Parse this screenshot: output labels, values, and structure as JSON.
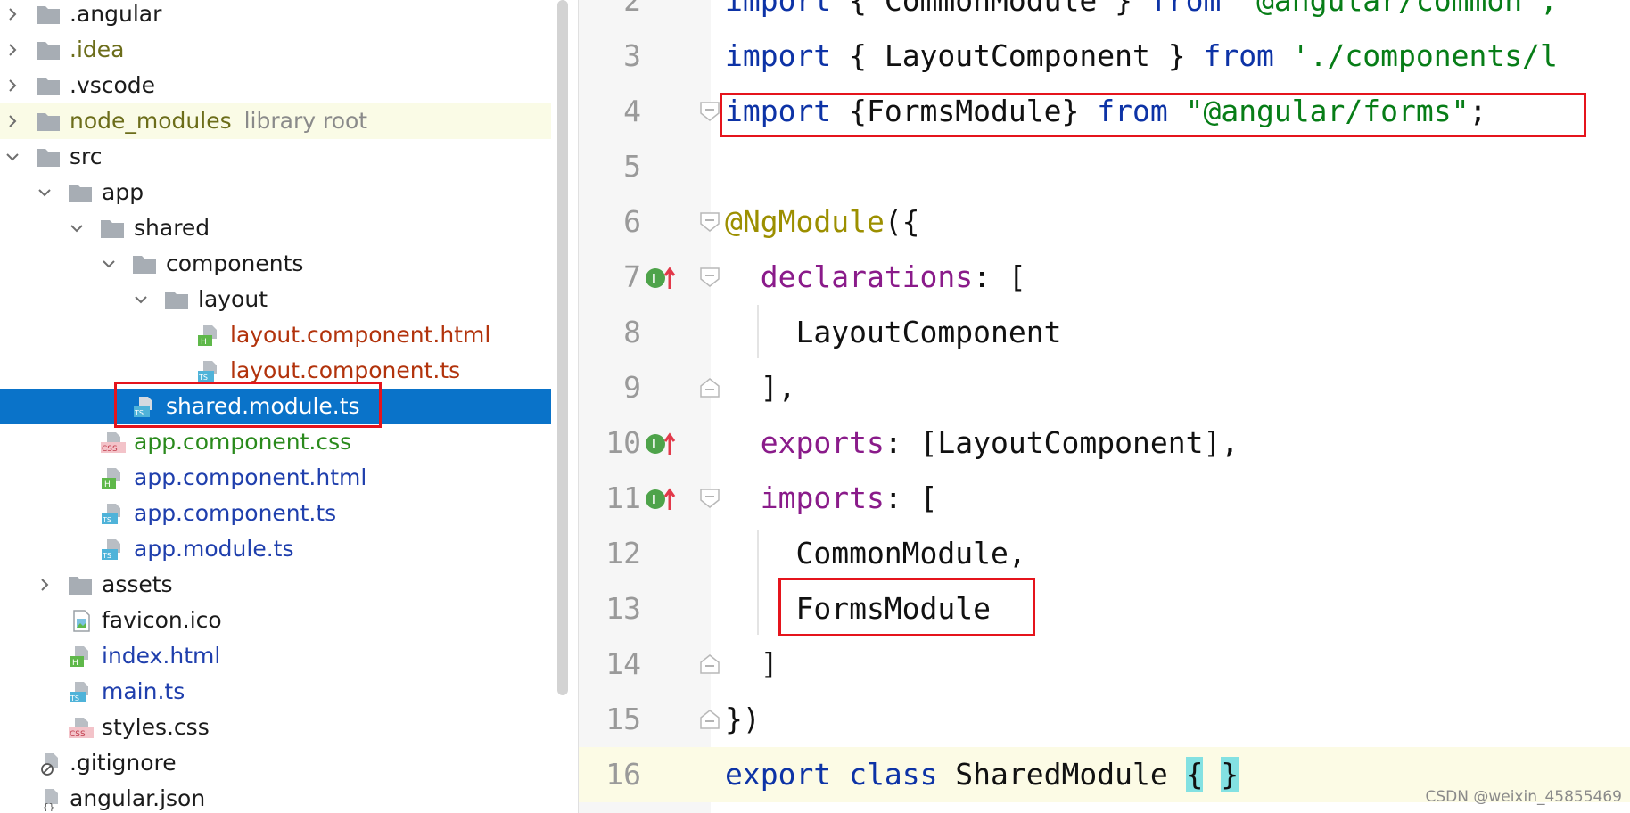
{
  "project_tree": {
    "items": [
      {
        "label": ".angular",
        "hint": "",
        "icon": "folder-icon",
        "expanded": false
      },
      {
        "label": ".idea",
        "hint": "",
        "icon": "folder-icon",
        "expanded": false
      },
      {
        "label": ".vscode",
        "hint": "",
        "icon": "folder-icon",
        "expanded": false
      },
      {
        "label": "node_modules",
        "hint": "library root",
        "icon": "folder-icon",
        "expanded": false
      },
      {
        "label": "src",
        "hint": "",
        "icon": "folder-icon",
        "expanded": true
      },
      {
        "label": "app",
        "hint": "",
        "icon": "folder-icon",
        "expanded": true
      },
      {
        "label": "shared",
        "hint": "",
        "icon": "folder-icon",
        "expanded": true
      },
      {
        "label": "components",
        "hint": "",
        "icon": "folder-icon",
        "expanded": true
      },
      {
        "label": "layout",
        "hint": "",
        "icon": "folder-icon",
        "expanded": true
      },
      {
        "label": "layout.component.html",
        "hint": "",
        "icon": "html-file-icon",
        "badge": "H"
      },
      {
        "label": "layout.component.ts",
        "hint": "",
        "icon": "ts-file-icon",
        "badge": "TS"
      },
      {
        "label": "shared.module.ts",
        "hint": "",
        "icon": "ts-file-icon",
        "badge": "TS",
        "selected": true
      },
      {
        "label": "app.component.css",
        "hint": "",
        "icon": "css-file-icon",
        "badge": "CSS"
      },
      {
        "label": "app.component.html",
        "hint": "",
        "icon": "html-file-icon",
        "badge": "H"
      },
      {
        "label": "app.component.ts",
        "hint": "",
        "icon": "ts-file-icon",
        "badge": "TS"
      },
      {
        "label": "app.module.ts",
        "hint": "",
        "icon": "ts-file-icon",
        "badge": "TS"
      },
      {
        "label": "assets",
        "hint": "",
        "icon": "folder-icon",
        "expanded": false
      },
      {
        "label": "favicon.ico",
        "hint": "",
        "icon": "image-file-icon"
      },
      {
        "label": "index.html",
        "hint": "",
        "icon": "html-file-icon",
        "badge": "H"
      },
      {
        "label": "main.ts",
        "hint": "",
        "icon": "ts-file-icon",
        "badge": "TS"
      },
      {
        "label": "styles.css",
        "hint": "",
        "icon": "css-file-icon",
        "badge": "CSS"
      },
      {
        "label": ".gitignore",
        "hint": "",
        "icon": "ignore-file-icon"
      },
      {
        "label": "angular.json",
        "hint": "",
        "icon": "json-file-icon"
      }
    ]
  },
  "editor": {
    "lines": [
      {
        "number": "2",
        "tokens": [
          {
            "t": "import",
            "c": "kw"
          },
          {
            "t": " { CommonModule } ",
            "c": ""
          },
          {
            "t": "from",
            "c": "kw"
          },
          {
            "t": " '@angular/common';",
            "c": "str"
          }
        ]
      },
      {
        "number": "3",
        "tokens": [
          {
            "t": "import",
            "c": "kw"
          },
          {
            "t": " { LayoutComponent } ",
            "c": ""
          },
          {
            "t": "from",
            "c": "kw"
          },
          {
            "t": " './components/l",
            "c": "str"
          }
        ]
      },
      {
        "number": "4",
        "tokens": [
          {
            "t": "import",
            "c": "kw"
          },
          {
            "t": " {FormsModule} ",
            "c": ""
          },
          {
            "t": "from",
            "c": "kw"
          },
          {
            "t": " \"@angular/forms\"",
            "c": "str"
          },
          {
            "t": ";",
            "c": ""
          }
        ]
      },
      {
        "number": "5",
        "tokens": []
      },
      {
        "number": "6",
        "tokens": [
          {
            "t": "@NgModule",
            "c": "ann"
          },
          {
            "t": "({",
            "c": ""
          }
        ]
      },
      {
        "number": "7",
        "tokens": [
          {
            "t": "  ",
            "c": ""
          },
          {
            "t": "declarations",
            "c": "prop"
          },
          {
            "t": ": [",
            "c": ""
          }
        ]
      },
      {
        "number": "8",
        "tokens": [
          {
            "t": "    LayoutComponent",
            "c": ""
          }
        ]
      },
      {
        "number": "9",
        "tokens": [
          {
            "t": "  ],",
            "c": ""
          }
        ]
      },
      {
        "number": "10",
        "tokens": [
          {
            "t": "  ",
            "c": ""
          },
          {
            "t": "exports",
            "c": "prop"
          },
          {
            "t": ": [LayoutComponent],",
            "c": ""
          }
        ]
      },
      {
        "number": "11",
        "tokens": [
          {
            "t": "  ",
            "c": ""
          },
          {
            "t": "imports",
            "c": "prop"
          },
          {
            "t": ": [",
            "c": ""
          }
        ]
      },
      {
        "number": "12",
        "tokens": [
          {
            "t": "    CommonModule,",
            "c": ""
          }
        ]
      },
      {
        "number": "13",
        "tokens": [
          {
            "t": "    FormsModule",
            "c": ""
          }
        ]
      },
      {
        "number": "14",
        "tokens": [
          {
            "t": "  ]",
            "c": ""
          }
        ]
      },
      {
        "number": "15",
        "tokens": [
          {
            "t": "})",
            "c": ""
          }
        ]
      },
      {
        "number": "16",
        "tokens": [
          {
            "t": "export",
            "c": "kw"
          },
          {
            "t": " ",
            "c": ""
          },
          {
            "t": "class",
            "c": "kw"
          },
          {
            "t": " SharedModule ",
            "c": ""
          },
          {
            "t": "{",
            "c": "brace-hl"
          },
          {
            "t": " ",
            "c": ""
          },
          {
            "t": "}",
            "c": "brace-hl"
          }
        ]
      }
    ]
  },
  "watermark": "CSDN @weixin_45855469",
  "colors": {
    "selection": "#0a73c9",
    "annotation_box": "#e5141c",
    "keyword": "#0d33a6",
    "string": "#077d17"
  }
}
